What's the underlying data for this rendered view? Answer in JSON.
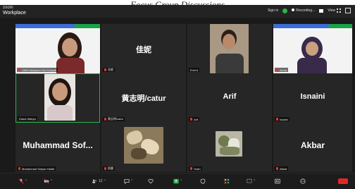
{
  "caption": "Focus Group Discussions",
  "app": {
    "brand_line1": "zoom",
    "brand_line2": "Workplace"
  },
  "topbar": {
    "sign_in": "Sign in",
    "recording": "Recording...",
    "view": "View"
  },
  "tiles": [
    {
      "name": "UMN Mahyana Dwi Cahyati",
      "type": "video"
    },
    {
      "name": "佳妮",
      "label": "佳妮",
      "type": "name"
    },
    {
      "name": "Emil A",
      "type": "video"
    },
    {
      "name": "Azma",
      "type": "video"
    },
    {
      "name": "Diana Wahyu",
      "type": "video"
    },
    {
      "name": "黄志明/catur",
      "label": "黄志明/catur",
      "type": "name"
    },
    {
      "name": "Arif",
      "label": "Arif",
      "type": "name"
    },
    {
      "name": "Isnaini",
      "label": "Isnaini",
      "type": "name"
    },
    {
      "name": "Muhammad Sofyan Habib",
      "label": "Muhammad Sof...",
      "type": "name"
    },
    {
      "name": "阳晨",
      "type": "image"
    },
    {
      "name": "Yosin",
      "type": "image"
    },
    {
      "name": "Akbar",
      "label": "Akbar",
      "type": "name"
    }
  ],
  "toolbar": {
    "participants_count": "12"
  },
  "colors": {
    "active_border": "#2bb24c",
    "mic_muted": "#ee3333",
    "tile_bg": "#262626"
  }
}
